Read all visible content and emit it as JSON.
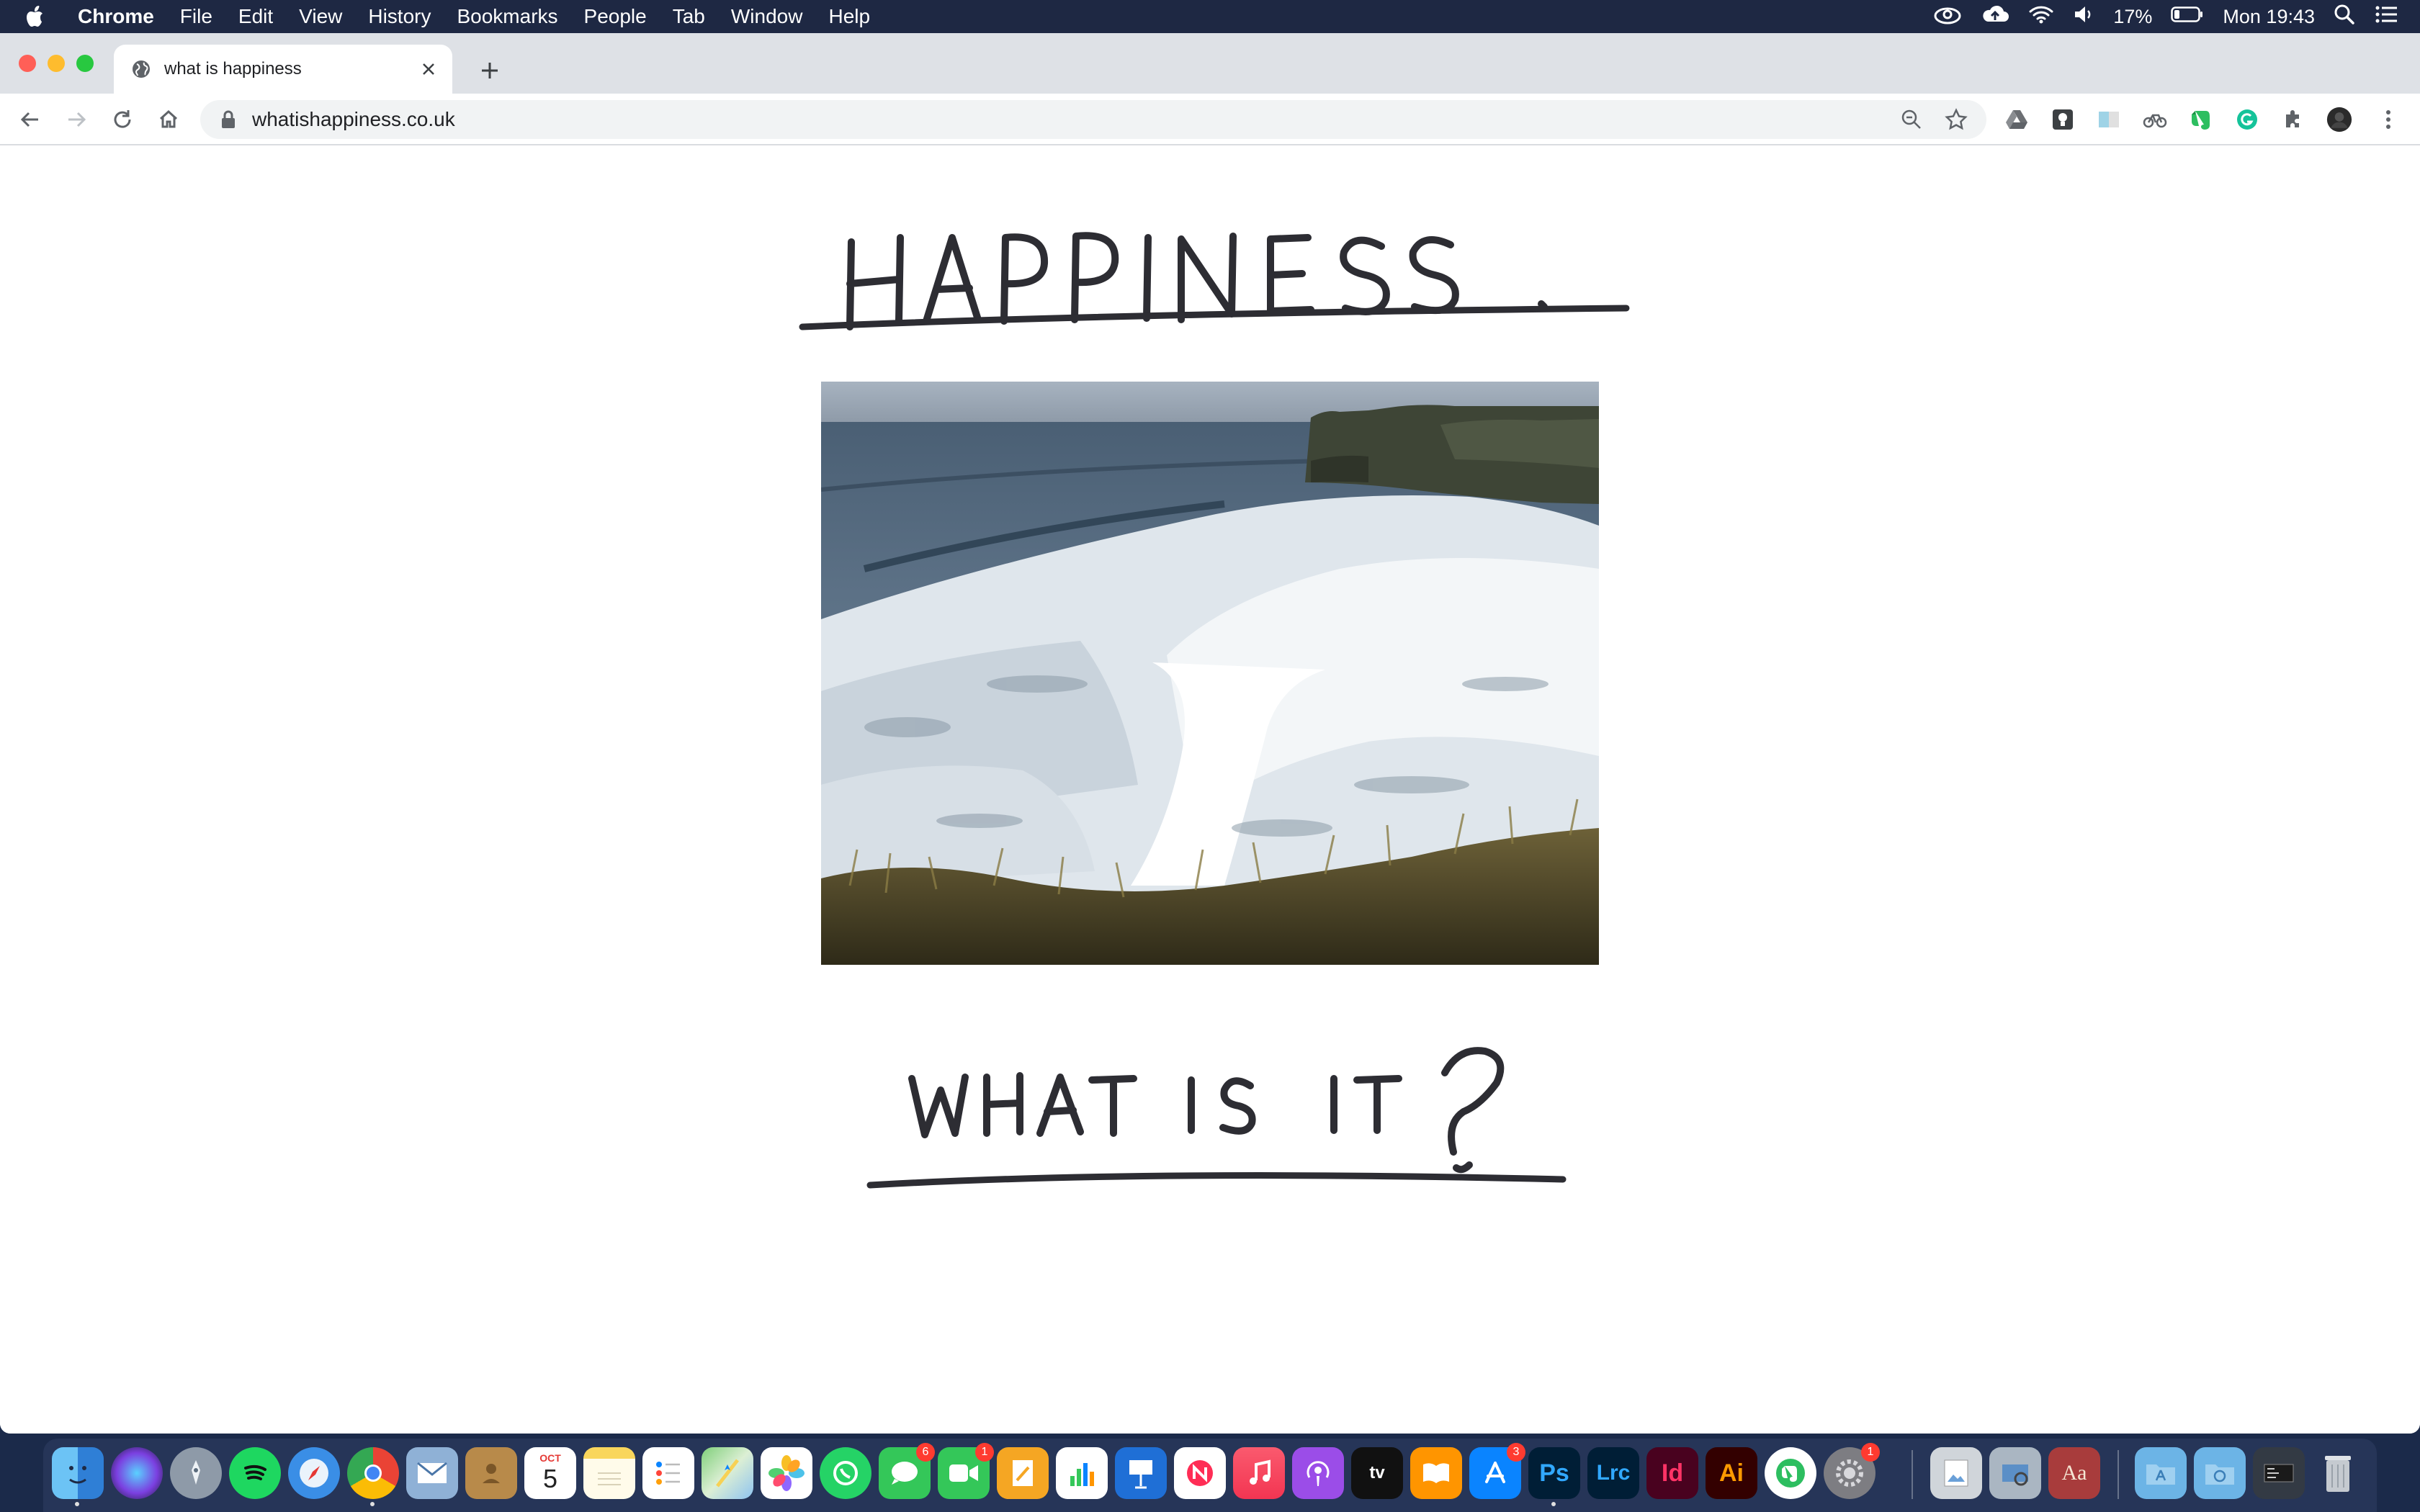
{
  "menubar": {
    "app_name": "Chrome",
    "items": [
      "File",
      "Edit",
      "View",
      "History",
      "Bookmarks",
      "People",
      "Tab",
      "Window",
      "Help"
    ],
    "battery": "17%",
    "clock": "Mon 19:43",
    "status_icons": [
      "creative-cloud-icon",
      "upload-icon",
      "wifi-icon",
      "volume-icon",
      "battery-icon",
      "spotlight-icon",
      "control-center-icon"
    ]
  },
  "browser": {
    "tab_title": "what is happiness",
    "url": "whatishappiness.co.uk",
    "extension_icons": [
      "google-drive-icon",
      "lightbulb-extension-icon",
      "image-extension-icon",
      "bike-extension-icon",
      "evernote-icon",
      "grammarly-icon",
      "extensions-puzzle-icon",
      "profile-avatar-icon",
      "menu-kebab-icon"
    ]
  },
  "page": {
    "heading_text": "HAPPINESS.",
    "subheading_text": "WHAT IS IT?",
    "image_alt": "Waves crashing below sea cliffs"
  },
  "dock": {
    "apps": [
      {
        "name": "Finder",
        "label": ""
      },
      {
        "name": "Siri",
        "label": ""
      },
      {
        "name": "Launchpad",
        "label": ""
      },
      {
        "name": "Spotify",
        "label": ""
      },
      {
        "name": "Safari",
        "label": ""
      },
      {
        "name": "Chrome",
        "label": ""
      },
      {
        "name": "Mail",
        "label": ""
      },
      {
        "name": "Contacts",
        "label": ""
      },
      {
        "name": "Calendar",
        "label": "5",
        "month": "OCT"
      },
      {
        "name": "Notes",
        "label": ""
      },
      {
        "name": "Reminders",
        "label": ""
      },
      {
        "name": "Maps",
        "label": ""
      },
      {
        "name": "Photos",
        "label": ""
      },
      {
        "name": "WhatsApp",
        "label": ""
      },
      {
        "name": "Messages",
        "label": "",
        "badge": "6"
      },
      {
        "name": "FaceTime",
        "label": "",
        "badge": "1"
      },
      {
        "name": "Pages",
        "label": ""
      },
      {
        "name": "Numbers",
        "label": ""
      },
      {
        "name": "Keynote",
        "label": ""
      },
      {
        "name": "News",
        "label": ""
      },
      {
        "name": "Music",
        "label": ""
      },
      {
        "name": "Podcasts",
        "label": ""
      },
      {
        "name": "TV",
        "label": "tv"
      },
      {
        "name": "Books",
        "label": ""
      },
      {
        "name": "App Store",
        "label": "",
        "badge": "3"
      },
      {
        "name": "Photoshop",
        "label": "Ps"
      },
      {
        "name": "Lightroom Classic",
        "label": "Lrc"
      },
      {
        "name": "InDesign",
        "label": "Id"
      },
      {
        "name": "Illustrator",
        "label": "Ai"
      },
      {
        "name": "Evernote",
        "label": ""
      },
      {
        "name": "System Preferences",
        "label": "",
        "badge": "1"
      },
      {
        "name": "Preview",
        "label": ""
      },
      {
        "name": "Image Capture",
        "label": ""
      },
      {
        "name": "Dictionary",
        "label": "Aa"
      },
      {
        "name": "Applications Folder",
        "label": ""
      },
      {
        "name": "Downloads Folder",
        "label": ""
      },
      {
        "name": "Screenshots Stack",
        "label": ""
      },
      {
        "name": "Trash",
        "label": ""
      }
    ]
  }
}
